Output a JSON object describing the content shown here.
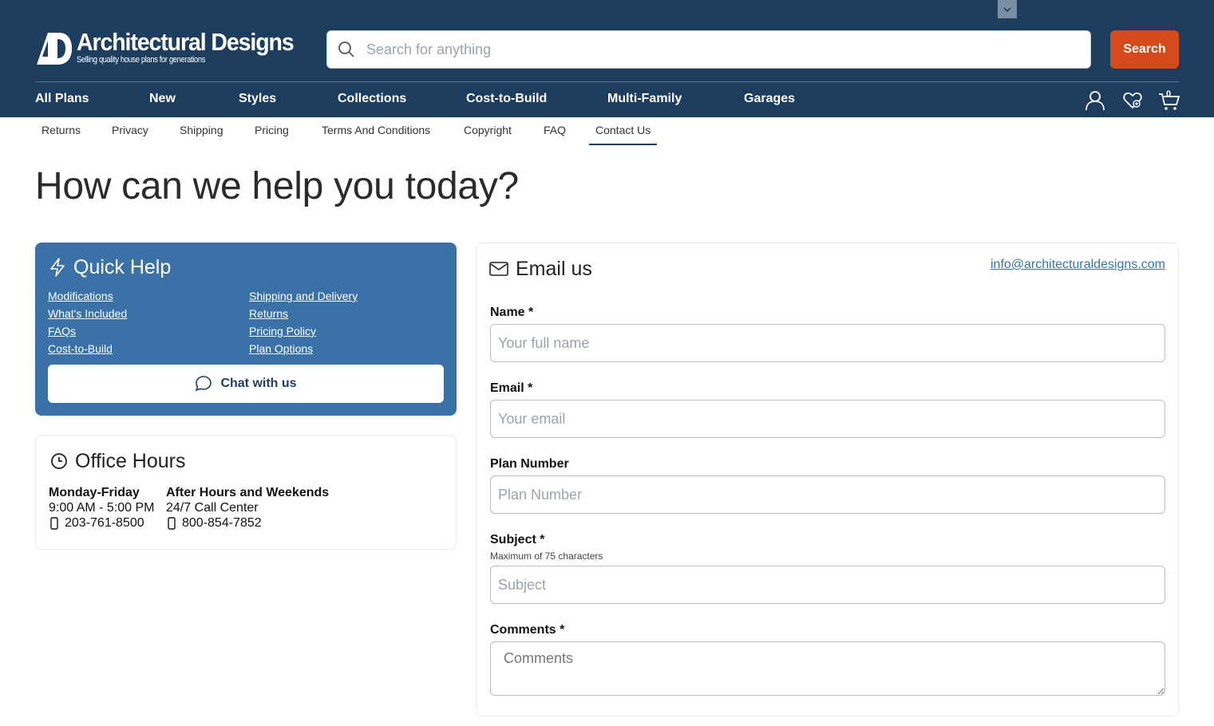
{
  "header": {
    "logo": {
      "title": "Architectural Designs",
      "tagline": "Selling quality house plans for generations",
      "mark": "AD"
    },
    "search": {
      "placeholder": "Search for anything",
      "button_label": "Search"
    },
    "nav": [
      "All Plans",
      "New",
      "Styles",
      "Collections",
      "Cost-to-Build",
      "Multi-Family",
      "Garages"
    ],
    "icons": {
      "account": "user-icon",
      "favorites": "heart-icon",
      "cart": "cart-icon"
    },
    "cart_count": "0"
  },
  "subnav": {
    "items": [
      "Returns",
      "Privacy",
      "Shipping",
      "Pricing",
      "Terms And Conditions",
      "Copyright",
      "FAQ",
      "Contact Us"
    ],
    "active": "Contact Us"
  },
  "page": {
    "title": "How can we help you today?"
  },
  "quick_help": {
    "title": "Quick Help",
    "links_left": [
      "Modifications",
      "What's Included",
      "FAQs",
      "Cost-to-Build"
    ],
    "links_right": [
      "Shipping and Delivery",
      "Returns",
      "Pricing Policy",
      "Plan Options"
    ],
    "chat_label": "Chat with us"
  },
  "office_hours": {
    "title": "Office Hours",
    "weekday": {
      "heading": "Monday-Friday",
      "hours": "9:00 AM - 5:00 PM",
      "phone": "203-761-8500"
    },
    "after_hours": {
      "heading": "After Hours and Weekends",
      "hours": "24/7 Call Center",
      "phone": "800-854-7852"
    }
  },
  "email_form": {
    "title": "Email us",
    "email_address": "info@architecturaldesigns.com",
    "fields": {
      "name": {
        "label": "Name *",
        "placeholder": "Your full name"
      },
      "email": {
        "label": "Email *",
        "placeholder": "Your email"
      },
      "plan_number": {
        "label": "Plan Number",
        "placeholder": "Plan Number"
      },
      "subject": {
        "label": "Subject *",
        "hint": "Maximum of 75 characters",
        "placeholder": "Subject"
      },
      "comments": {
        "label": "Comments *",
        "placeholder": "Comments"
      }
    }
  },
  "colors": {
    "header_bg": "#1d3d5e",
    "search_button": "#d54a1b",
    "quick_help_bg": "#3a72a8",
    "link": "#3a72a8"
  }
}
